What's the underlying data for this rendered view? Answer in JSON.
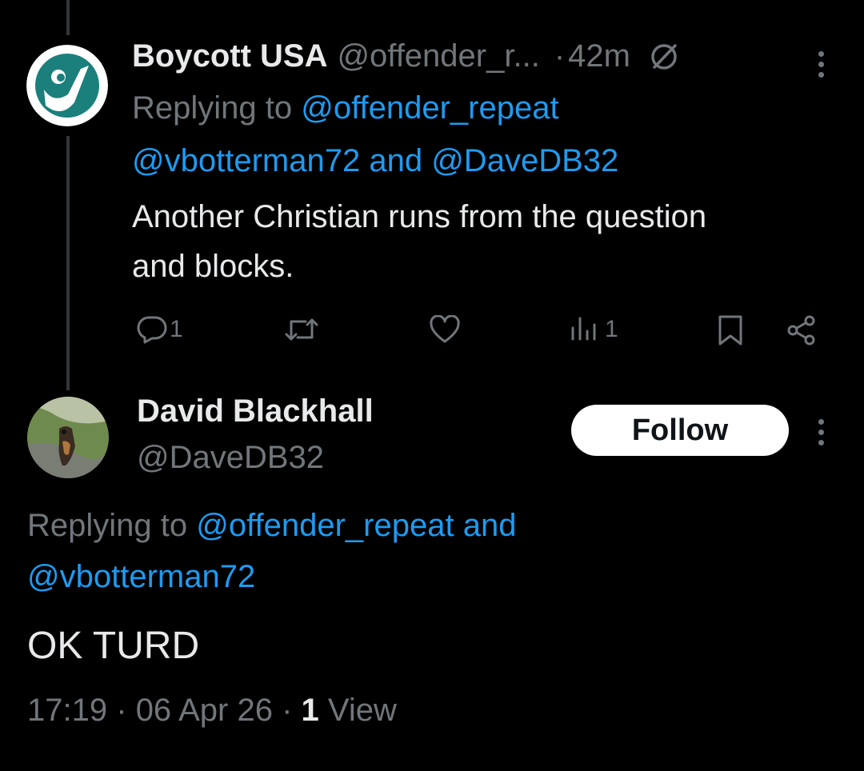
{
  "tweet1": {
    "display_name": "Boycott USA",
    "handle": "@offender_r...",
    "time": "42m",
    "replying_to_prefix": "Replying to",
    "replying_to_handle1": "@offender_repeat",
    "replying_to_handle2": "@vbotterman72",
    "replying_to_and": "and",
    "replying_to_handle3": "@DaveDB32",
    "body_line1": "Another Christian runs from the question",
    "body_line2": "and blocks.",
    "reply_count": "1",
    "view_count": "1",
    "avatar_bg": "#1b7f7c"
  },
  "tweet2": {
    "display_name": "David Blackhall",
    "handle": "@DaveDB32",
    "follow_label": "Follow",
    "replying_to_prefix": "Replying to",
    "replying_to_handle1": "@offender_repeat",
    "replying_to_and": "and",
    "replying_to_handle2": "@vbotterman72",
    "body": "OK TURD",
    "time": "17:19",
    "date": "06 Apr 26",
    "views_count": "1",
    "views_label": "View"
  },
  "colors": {
    "background": "#000000",
    "text": "#e7e9ea",
    "muted": "#71767b",
    "link": "#1d9bf0",
    "thread_line": "#333639"
  },
  "icons": [
    "reply-icon",
    "retweet-icon",
    "like-icon",
    "views-icon",
    "bookmark-icon",
    "share-icon",
    "more-icon",
    "slash-circle-icon"
  ]
}
